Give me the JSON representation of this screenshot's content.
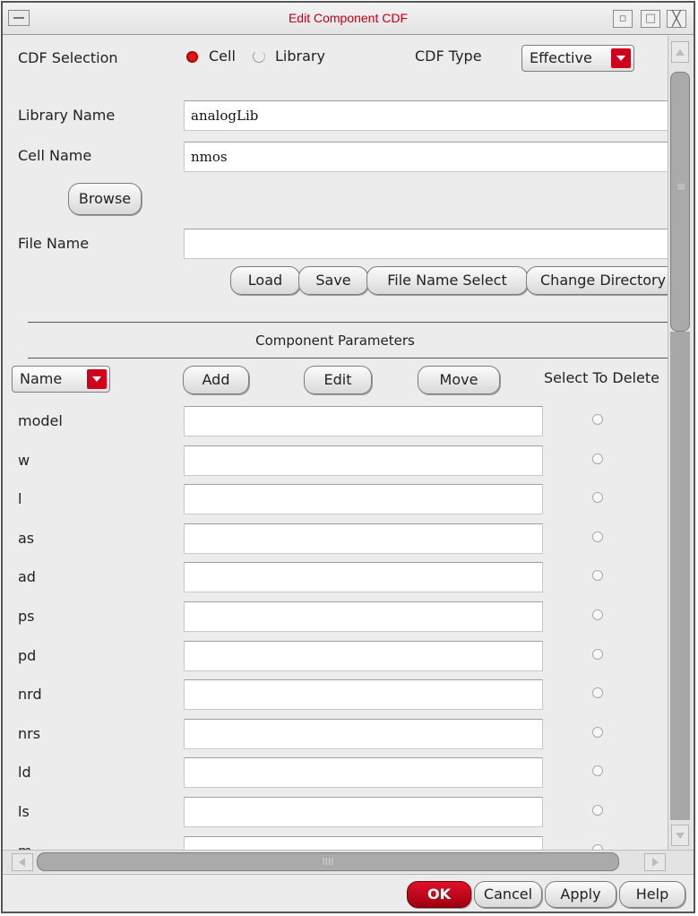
{
  "window": {
    "title": "Edit Component CDF",
    "controls": {
      "minimize": "▫",
      "maximize": "□",
      "close": "╳"
    }
  },
  "cdf_selection": {
    "label": "CDF Selection",
    "options": [
      {
        "label": "Cell",
        "selected": true
      },
      {
        "label": "Library",
        "selected": false
      }
    ]
  },
  "cdf_type": {
    "label": "CDF Type",
    "value": "Effective"
  },
  "library_name": {
    "label": "Library Name",
    "value": "analogLib"
  },
  "cell_name": {
    "label": "Cell Name",
    "value": "nmos"
  },
  "browse_button": "Browse",
  "file_name": {
    "label": "File Name",
    "value": ""
  },
  "file_buttons": [
    "Load",
    "Save",
    "File Name Select",
    "Change Directory"
  ],
  "component_parameters": {
    "heading": "Component Parameters",
    "sort_by": "Name",
    "buttons": [
      "Add",
      "Edit",
      "Move"
    ],
    "select_to_delete": "Select To Delete",
    "params": [
      {
        "name": "model",
        "value": ""
      },
      {
        "name": "w",
        "value": ""
      },
      {
        "name": "l",
        "value": ""
      },
      {
        "name": "as",
        "value": ""
      },
      {
        "name": "ad",
        "value": ""
      },
      {
        "name": "ps",
        "value": ""
      },
      {
        "name": "pd",
        "value": ""
      },
      {
        "name": "nrd",
        "value": ""
      },
      {
        "name": "nrs",
        "value": ""
      },
      {
        "name": "ld",
        "value": ""
      },
      {
        "name": "ls",
        "value": ""
      },
      {
        "name": "m",
        "value": ""
      }
    ]
  },
  "hscroll_grip": "IIII",
  "dialog_buttons": {
    "ok": "OK",
    "cancel": "Cancel",
    "apply": "Apply",
    "help": "Help"
  },
  "colors": {
    "accent": "#c0001a",
    "ok_button": "#c5001a",
    "title_text": "#c0001a"
  }
}
